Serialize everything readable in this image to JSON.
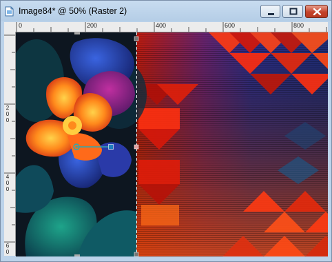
{
  "window": {
    "title": "Image84* @  50% (Raster 2)",
    "buttons": {
      "minimize": "minimize",
      "maximize": "maximize",
      "close": "close"
    }
  },
  "ruler": {
    "h_labels": [
      "0",
      "200",
      "400",
      "600",
      "800"
    ],
    "v_labels": [
      "2",
      "0",
      "0",
      "4",
      "0",
      "0",
      "6",
      "0"
    ]
  },
  "canvas": {
    "description_icons": [
      "app-icon"
    ],
    "colors": {
      "accent_guide": "#2fa8b0",
      "accent_handle": "#1f7fbf",
      "guide_line": "#ffffff"
    }
  }
}
